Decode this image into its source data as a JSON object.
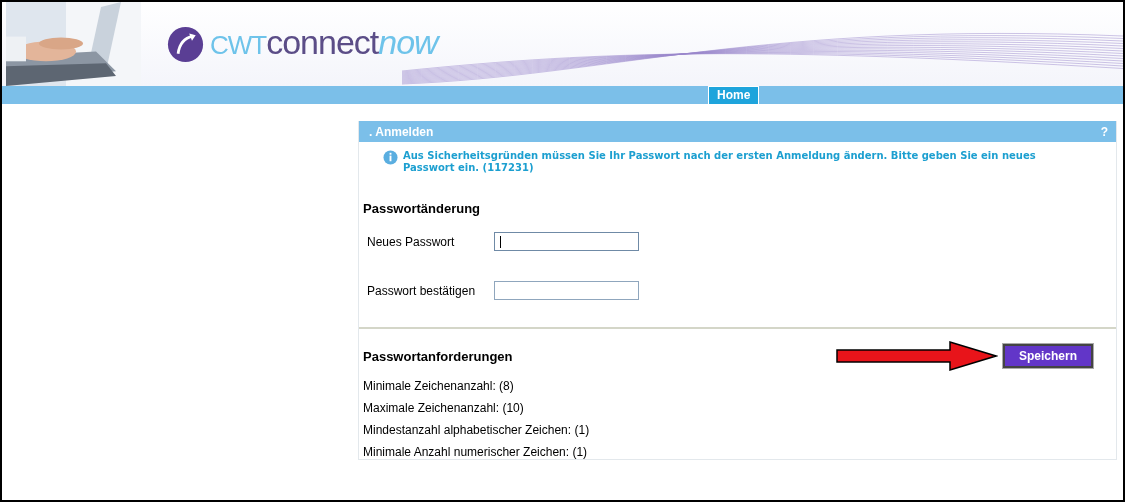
{
  "header": {
    "logo": {
      "prefix": "CWT",
      "name": "connect",
      "suffix": "now"
    }
  },
  "nav": {
    "tabs": [
      {
        "label": "Home",
        "selected": true
      }
    ]
  },
  "panel": {
    "title": "Anmelden",
    "help": "?",
    "bullet": ".",
    "message": "Aus Sicherheitsgründen müssen Sie Ihr Passwort nach der ersten Anmeldung ändern. Bitte geben Sie ein neues Passwort ein. (117231)",
    "form": {
      "heading": "Passwortänderung",
      "fields": [
        {
          "label": "Neues Passwort",
          "focused": true
        },
        {
          "label": "Passwort bestätigen",
          "focused": false
        }
      ]
    },
    "requirements": {
      "heading": "Passwortanforderungen",
      "items": [
        "Minimale Zeichenanzahl: (8)",
        "Maximale Zeichenanzahl: (10)",
        "Mindestanzahl alphabetischer Zeichen: (1)",
        "Minimale Anzahl numerischer Zeichen: (1)"
      ]
    },
    "save_button": "Speichern"
  }
}
